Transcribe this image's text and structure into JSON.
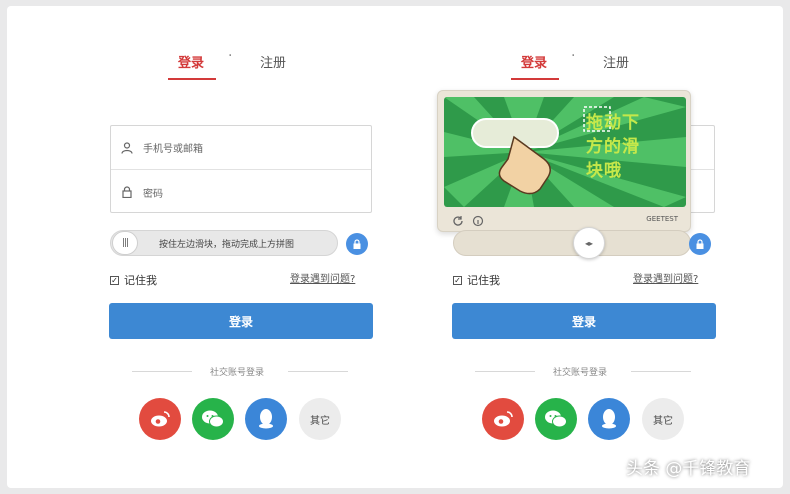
{
  "left_panel": {
    "tabs": {
      "login": "登录",
      "separator": "·",
      "register": "注册"
    },
    "fields": {
      "account_placeholder": "手机号或邮箱",
      "password_placeholder": "密码"
    },
    "slider_text": "按住左边滑块，拖动完成上方拼图",
    "slider_knob": "|||",
    "remember": "记住我",
    "forgot": "登录遇到问题?",
    "login_button": "登录",
    "third_party": "社交账号登录",
    "other": "其它"
  },
  "right_panel": {
    "tabs": {
      "login": "登录",
      "separator": "·",
      "register": "注册"
    },
    "captcha_text_line1": "拖动下",
    "captcha_text_line2": "方的滑",
    "captcha_text_line3": "块哦",
    "captcha_brand": "GEETEST",
    "track_knob": "◂▸",
    "remember": "记住我",
    "forgot": "登录遇到问题?",
    "login_button": "登录",
    "third_party": "社交账号登录",
    "other": "其它"
  },
  "watermark": "头条 @千锋教育",
  "colors": {
    "accent_red": "#d33a3a",
    "primary_blue": "#3d88d3",
    "weibo": "#e24b3f",
    "wechat": "#27b34a",
    "qq": "#3b86d8"
  }
}
